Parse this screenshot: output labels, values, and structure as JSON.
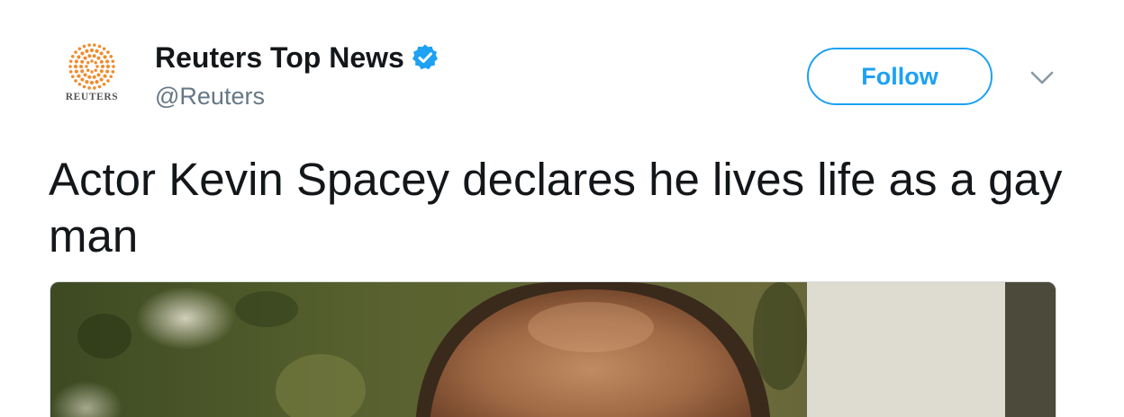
{
  "account": {
    "display_name": "Reuters Top News",
    "handle": "@Reuters",
    "verified": true,
    "verified_icon": "verified-badge-icon",
    "avatar_wordmark": "REUTERS"
  },
  "actions": {
    "follow_label": "Follow",
    "menu_icon": "chevron-down-icon"
  },
  "tweet": {
    "text": "Actor Kevin Spacey declares he lives life as a gay man"
  },
  "colors": {
    "accent": "#1da1f2",
    "text_primary": "#14171a",
    "text_secondary": "#657786",
    "reuters_orange": "#f08c2e"
  }
}
